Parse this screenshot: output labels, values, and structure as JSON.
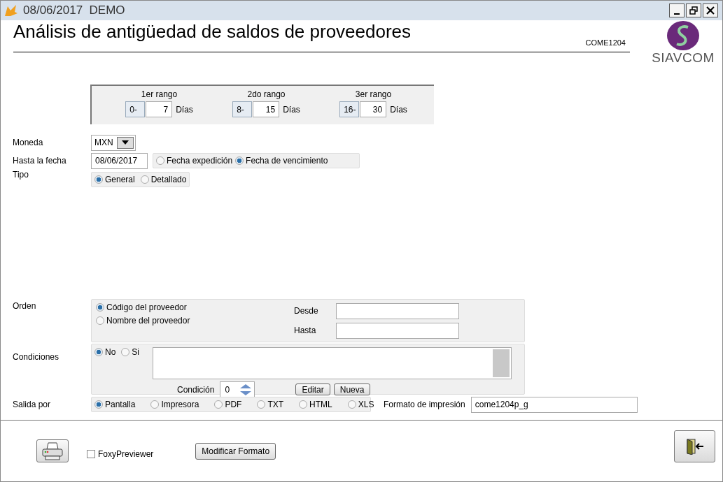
{
  "window": {
    "title": "08/06/2017  DEMO"
  },
  "header": {
    "title": "Análisis de antigüedad de saldos de proveedores",
    "code": "COME1204",
    "logo_text": "SIAVCOM"
  },
  "ranges": [
    {
      "label": "1er rango",
      "from": "0-",
      "to": "7",
      "unit": "Días"
    },
    {
      "label": "2do rango",
      "from": "8-",
      "to": "15",
      "unit": "Días"
    },
    {
      "label": "3er rango",
      "from": "16-",
      "to": "30",
      "unit": "Días"
    }
  ],
  "moneda": {
    "label": "Moneda",
    "value": "MXN"
  },
  "hasta_fecha": {
    "label": "Hasta la fecha",
    "value": "08/06/2017",
    "options": [
      {
        "label": "Fecha expedición",
        "selected": false
      },
      {
        "label": "Fecha de vencimiento",
        "selected": true
      }
    ]
  },
  "tipo": {
    "label": "Tipo",
    "options": [
      {
        "label": "General",
        "selected": true
      },
      {
        "label": "Detallado",
        "selected": false
      }
    ]
  },
  "orden": {
    "label": "Orden",
    "options": [
      {
        "label": "Código del proveedor",
        "selected": true
      },
      {
        "label": "Nombre del proveedor",
        "selected": false
      }
    ],
    "desde_label": "Desde",
    "hasta_label": "Hasta"
  },
  "condiciones": {
    "label": "Condiciones",
    "options": [
      {
        "label": "No",
        "selected": true
      },
      {
        "label": "Si",
        "selected": false
      }
    ],
    "condicion_label": "Condición",
    "condicion_value": "0",
    "buttons": [
      "Editar",
      "Nueva"
    ]
  },
  "salida": {
    "label": "Salida por",
    "options": [
      {
        "label": "Pantalla",
        "selected": true
      },
      {
        "label": "Impresora",
        "selected": false
      },
      {
        "label": "PDF",
        "selected": false
      },
      {
        "label": "TXT",
        "selected": false
      },
      {
        "label": "HTML",
        "selected": false
      },
      {
        "label": "XLS",
        "selected": false
      }
    ],
    "formato_label": "Formato de impresión",
    "formato_value": "come1204p_g"
  },
  "footer": {
    "foxy": {
      "label": "FoxyPreviewer",
      "checked": false
    },
    "modify_button": "Modificar Formato"
  }
}
